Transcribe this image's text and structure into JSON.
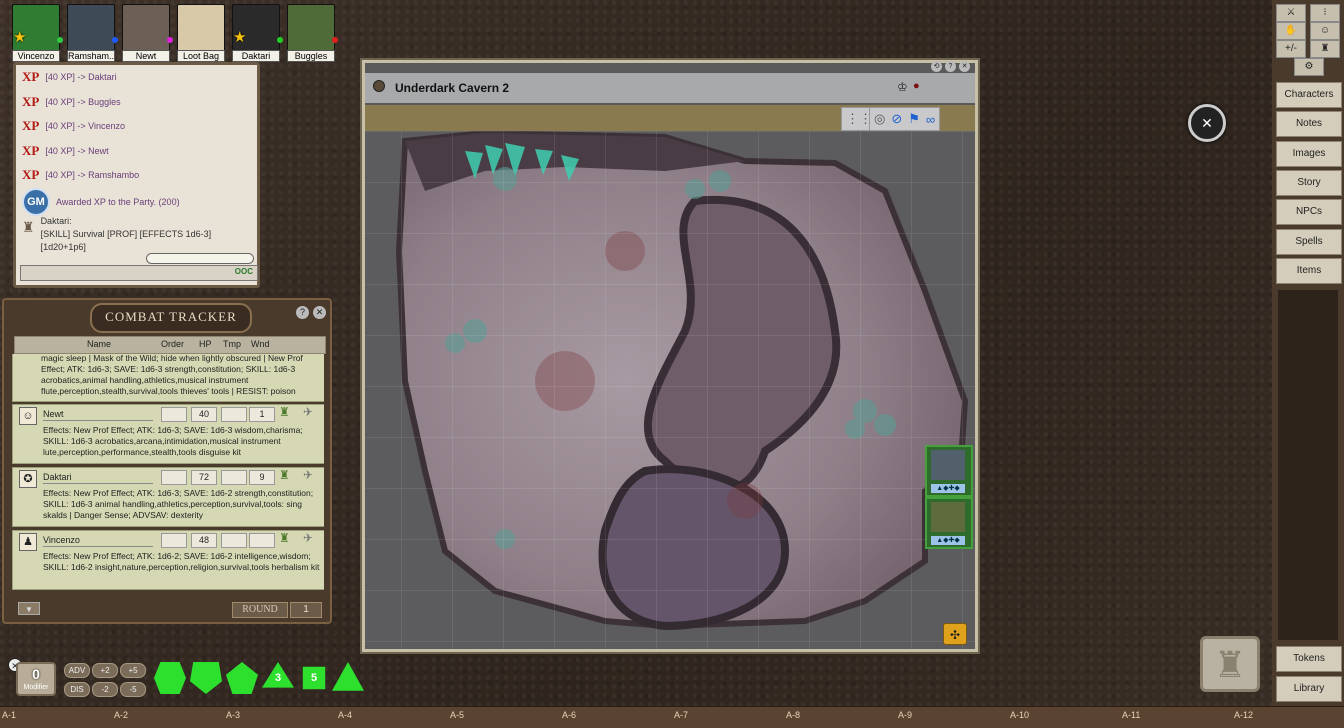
{
  "party": [
    {
      "name": "Vincenzo",
      "color": "#2e7d32",
      "dot": "#2ecc40",
      "star": true
    },
    {
      "name": "Ramsham...",
      "color": "#3e4a55",
      "dot": "#1e5bff",
      "star": false
    },
    {
      "name": "Newt",
      "color": "#6b5f56",
      "dot": "#e020e0",
      "star": false
    },
    {
      "name": "Loot Bag",
      "color": "#d8c9a8",
      "dot": "",
      "star": false
    },
    {
      "name": "Daktari",
      "color": "#2a2a2a",
      "dot": "#20d020",
      "star": true
    },
    {
      "name": "Buggles",
      "color": "#4f6b38",
      "dot": "#e02020",
      "star": false
    }
  ],
  "chat": {
    "xp_label": "XP",
    "lines": [
      "[40 XP] -> Daktari",
      "[40 XP] -> Buggles",
      "[40 XP] -> Vincenzo",
      "[40 XP] -> Newt",
      "[40 XP] -> Ramshambo"
    ],
    "gm_badge": "GM",
    "gm_line": "Awarded XP to the Party. (200)",
    "roll_name": "Daktari:",
    "roll_text": "[SKILL] Survival [PROF] [EFFECTS 1d6-3] [1d20+1p6]",
    "ooc": "OOC"
  },
  "combat_tracker": {
    "title": "COMBAT TRACKER",
    "columns": {
      "name": "Name",
      "order": "Order",
      "hp": "HP",
      "tmp": "Tmp",
      "wnd": "Wnd"
    },
    "top_text": "magic sleep | Mask of the Wild; hide when lightly obscured | New Prof Effect; ATK: 1d6-3; SAVE: 1d6-3 strength,constitution; SKILL: 1d6-3 acrobatics,animal handling,athletics,musical instrument flute,perception,stealth,survival,tools thieves' tools | RESIST: poison",
    "entries": [
      {
        "name": "Newt",
        "hp": "40",
        "tmp": "",
        "wnd": "1",
        "effects": "Effects: New Prof Effect; ATK: 1d6-3; SAVE: 1d6-3 wisdom,charisma; SKILL: 1d6-3 acrobatics,arcana,intimidation,musical instrument lute,perception,performance,stealth,tools disguise kit"
      },
      {
        "name": "Daktari",
        "hp": "72",
        "tmp": "",
        "wnd": "9",
        "effects": "Effects: New Prof Effect; ATK: 1d6-3; SAVE: 1d6-2 strength,constitution; SKILL: 1d6-3 animal handling,athletics,perception,survival,tools: sing skalds | Danger Sense; ADVSAV: dexterity"
      },
      {
        "name": "Vincenzo",
        "hp": "48",
        "tmp": "",
        "wnd": "",
        "effects": "Effects: New Prof Effect; ATK: 1d6-2; SAVE: 1d6-2 intelligence,wisdom; SKILL: 1d6-2 insight,nature,perception,religion,survival,tools herbalism kit"
      }
    ],
    "round_label": "ROUND",
    "round_value": "1"
  },
  "map": {
    "title": "Underdark Cavern 2"
  },
  "sidebar": [
    "Characters",
    "Notes",
    "Images",
    "Story",
    "NPCs",
    "Spells",
    "Items"
  ],
  "sidebar_bottom": [
    "Tokens",
    "Library"
  ],
  "top_icons": [
    "⚔",
    "⁝",
    "✋",
    "☺",
    "+/-",
    "♜"
  ],
  "modifier": {
    "value": "0",
    "label": "Modifier"
  },
  "mod_buttons": [
    "ADV",
    "+2",
    "+5",
    "DIS",
    "-2",
    "-5"
  ],
  "dice": [
    "d4",
    "d6",
    "d8",
    "d10",
    "d12",
    "d20"
  ],
  "coords": [
    "A-1",
    "A-2",
    "A-3",
    "A-4",
    "A-5",
    "A-6",
    "A-7",
    "A-8",
    "A-9",
    "A-10",
    "A-11",
    "A-12"
  ]
}
